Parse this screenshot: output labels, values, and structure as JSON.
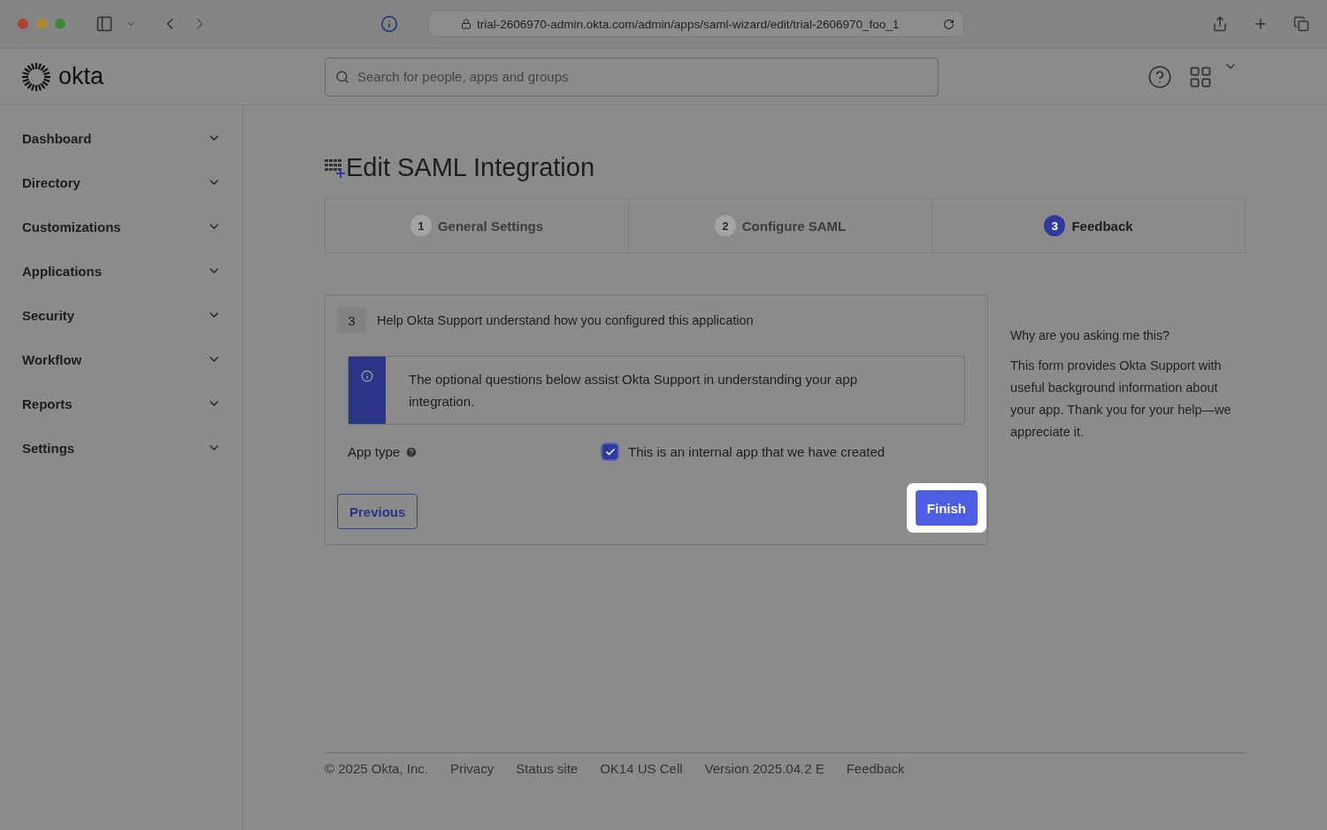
{
  "browser": {
    "url": "trial-2606970-admin.okta.com/admin/apps/saml-wizard/edit/trial-2606970_foo_1"
  },
  "header": {
    "logo": "okta",
    "search": {
      "placeholder": "Search for people, apps and groups"
    }
  },
  "sidebar": {
    "items": [
      {
        "label": "Dashboard",
        "expanded": false
      },
      {
        "label": "Directory",
        "expanded": false
      },
      {
        "label": "Customizations",
        "expanded": false
      },
      {
        "label": "Applications",
        "expanded": false
      },
      {
        "label": "Security",
        "expanded": false
      },
      {
        "label": "Workflow",
        "expanded": false
      },
      {
        "label": "Reports",
        "expanded": false
      },
      {
        "label": "Settings",
        "expanded": false
      }
    ]
  },
  "page": {
    "title": "Edit SAML Integration",
    "steps": [
      {
        "number": "1",
        "label": "General Settings",
        "selected": false
      },
      {
        "number": "2",
        "label": "Configure SAML",
        "selected": false
      },
      {
        "number": "3",
        "label": "Feedback",
        "selected": true
      }
    ],
    "card": {
      "number": "3",
      "heading": "Help Okta Support understand how you configured this application",
      "info": "The optional questions below assist Okta Support in understanding your app integration.",
      "field_label": "App type",
      "checkbox": {
        "label": "This is an internal app that we have created",
        "checked": true
      },
      "buttons": [
        {
          "label": "Previous",
          "kind": "secondary",
          "highlighted": false
        },
        {
          "label": "Finish",
          "kind": "primary",
          "highlighted": true
        }
      ]
    },
    "aside": {
      "heading": "Why are you asking me this?",
      "text": "This form provides Okta Support with useful background information about your app. Thank you for your help—we appreciate it."
    }
  },
  "footer": [
    "© 2025 Okta, Inc.",
    "Privacy",
    "Status site",
    "OK14 US Cell",
    "Version 2025.04.2 E",
    "Feedback"
  ]
}
